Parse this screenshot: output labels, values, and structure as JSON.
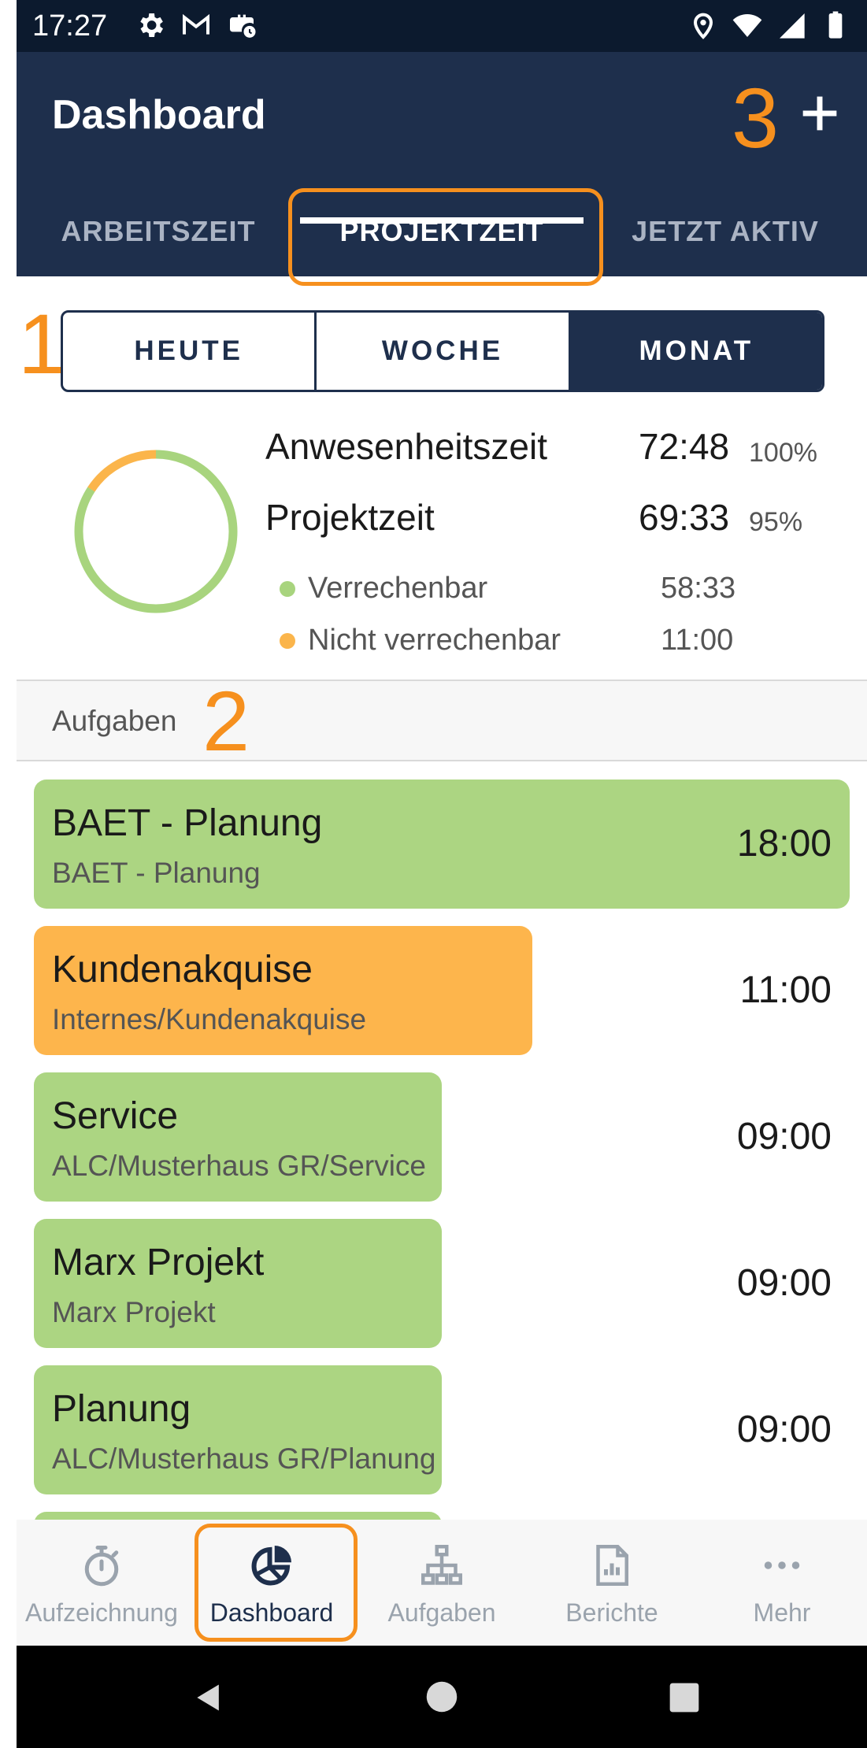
{
  "status_bar": {
    "time": "17:27"
  },
  "app_bar": {
    "title": "Dashboard",
    "annotation_3": "3"
  },
  "tabs": [
    {
      "label": "ARBEITSZEIT",
      "active": false
    },
    {
      "label": "PROJEKTZEIT",
      "active": true
    },
    {
      "label": "JETZT AKTIV",
      "active": false
    }
  ],
  "annotations": {
    "one": "1",
    "two": "2",
    "three": "3"
  },
  "period_selector": {
    "options": [
      "HEUTE",
      "WOCHE",
      "MONAT"
    ],
    "selected": "MONAT"
  },
  "summary": {
    "presence": {
      "label": "Anwesenheitszeit",
      "value": "72:48",
      "percent": "100%"
    },
    "project": {
      "label": "Projektzeit",
      "value": "69:33",
      "percent": "95%"
    },
    "billable": {
      "label": "Verrechenbar",
      "value": "58:33",
      "color": "#a8d47e"
    },
    "non_billable": {
      "label": "Nicht verrechenbar",
      "value": "11:00",
      "color": "#fbb54b"
    }
  },
  "section": {
    "label": "Aufgaben"
  },
  "tasks": [
    {
      "title": "BAET - Planung",
      "subtitle": "BAET - Planung",
      "time": "18:00",
      "color": "#acd582",
      "fraction": 1.0
    },
    {
      "title": "Kundenakquise",
      "subtitle": "Internes/Kundenakquise",
      "time": "11:00",
      "color": "#fdb54c",
      "fraction": 0.611
    },
    {
      "title": "Service",
      "subtitle": "ALC/Musterhaus GR/Service",
      "time": "09:00",
      "color": "#acd582",
      "fraction": 0.5
    },
    {
      "title": "Marx Projekt",
      "subtitle": "Marx Projekt",
      "time": "09:00",
      "color": "#acd582",
      "fraction": 0.5
    },
    {
      "title": "Planung",
      "subtitle": "ALC/Musterhaus GR/Planung",
      "time": "09:00",
      "color": "#acd582",
      "fraction": 0.5
    }
  ],
  "bottom_nav": [
    {
      "label": "Aufzeichnung",
      "icon": "stopwatch-icon",
      "active": false
    },
    {
      "label": "Dashboard",
      "icon": "pie-chart-icon",
      "active": true
    },
    {
      "label": "Aufgaben",
      "icon": "hierarchy-icon",
      "active": false
    },
    {
      "label": "Berichte",
      "icon": "report-icon",
      "active": false
    },
    {
      "label": "Mehr",
      "icon": "more-icon",
      "active": false
    }
  ],
  "colors": {
    "primary": "#1e2f4c",
    "accent_annotation": "#f6901e",
    "billable": "#a8d47e",
    "non_billable": "#fbb54b"
  }
}
